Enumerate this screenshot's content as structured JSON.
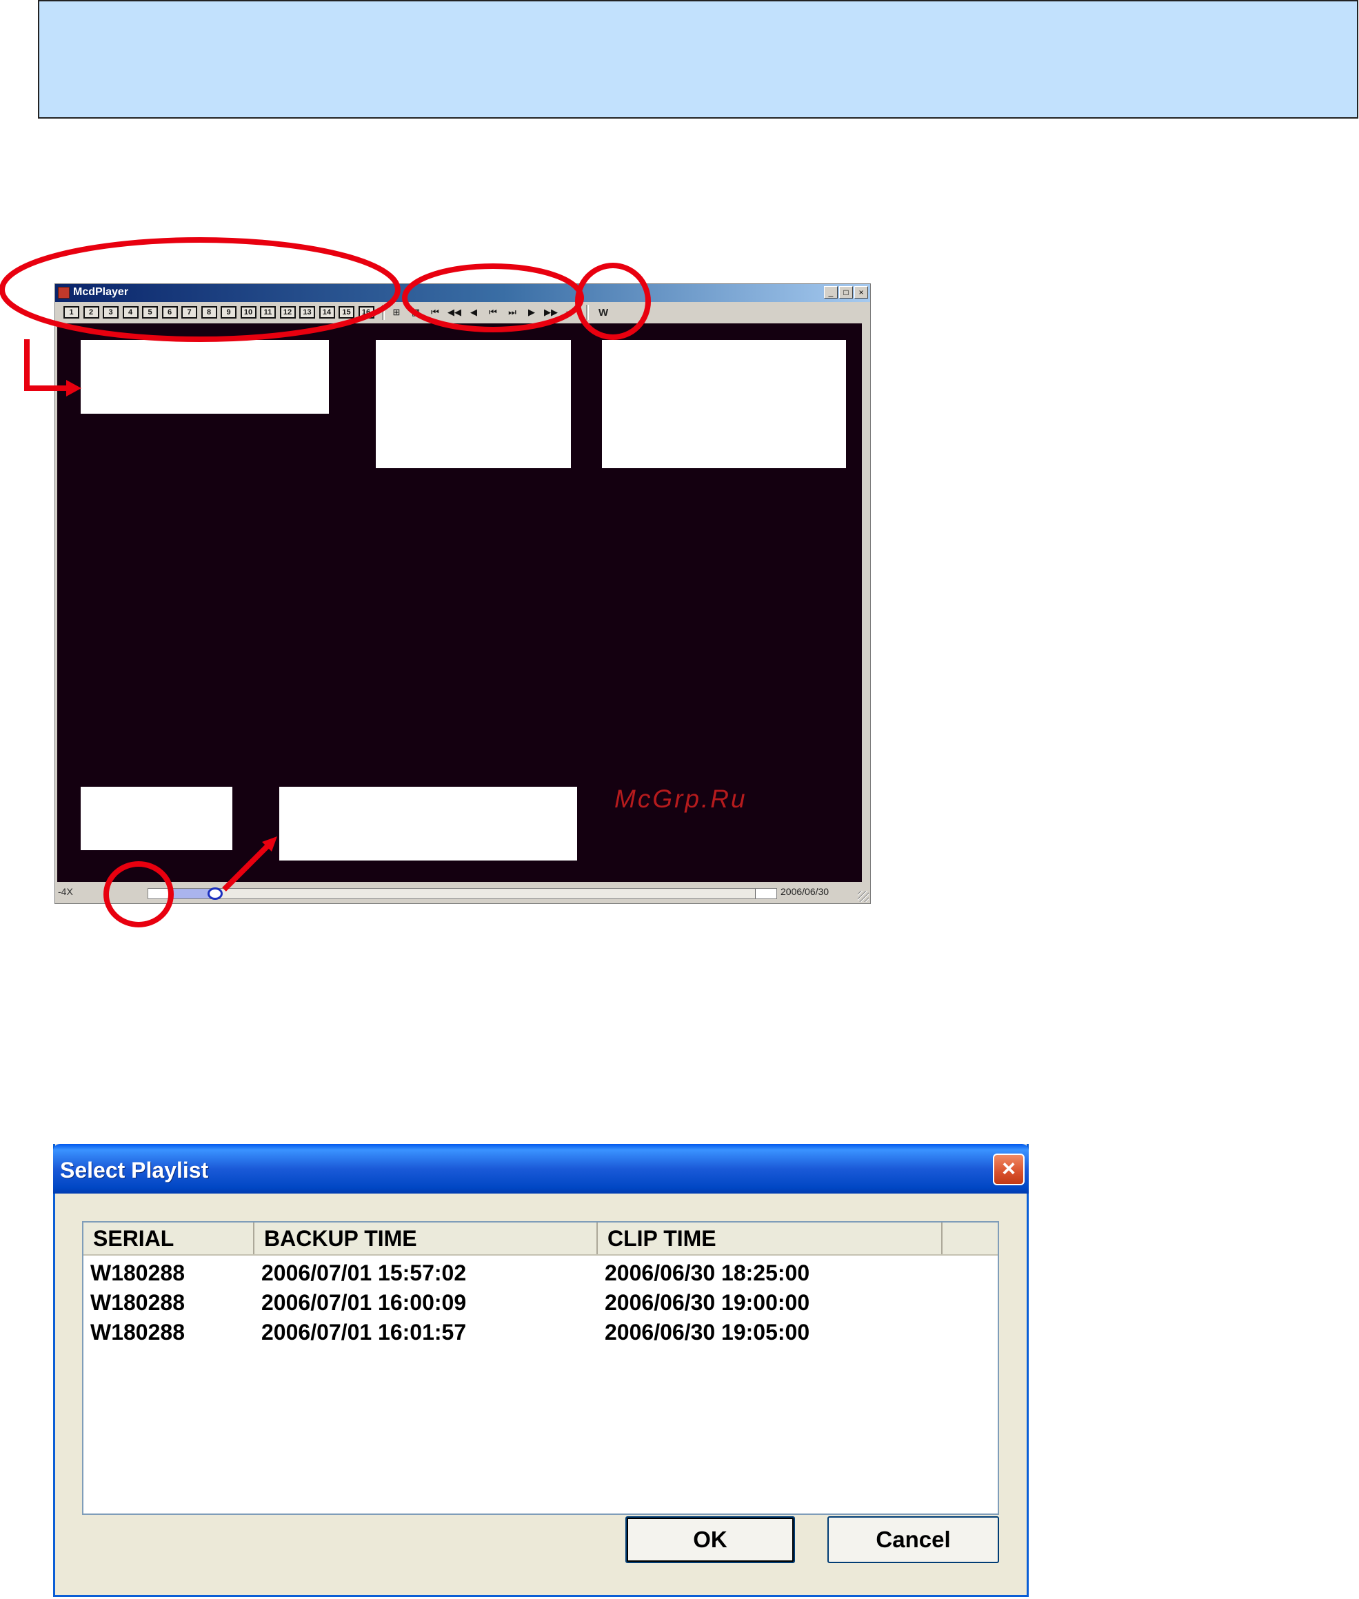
{
  "player": {
    "title": "McdPlayer",
    "window_buttons": [
      "_",
      "□",
      "×"
    ],
    "channel_buttons": [
      "1",
      "2",
      "3",
      "4",
      "5",
      "6",
      "7",
      "8",
      "9",
      "10",
      "11",
      "12",
      "13",
      "14",
      "15",
      "16"
    ],
    "transport_icons": [
      "quad-view-icon",
      "grid-view-icon",
      "fast-rewind-icon",
      "rewind-icon",
      "play-reverse-icon",
      "step-back-icon",
      "step-forward-icon",
      "play-icon",
      "fast-forward-icon",
      "skip-end-icon"
    ],
    "w_button": "W",
    "speed": "-4X",
    "date": "2006/06/30",
    "seek_position": 0.075
  },
  "watermark": "McGrp.Ru",
  "playlist_dialog": {
    "title": "Select Playlist",
    "close_glyph": "×",
    "columns": [
      "SERIAL",
      "BACKUP TIME",
      "CLIP TIME"
    ],
    "rows": [
      [
        "W180288",
        "2006/07/01 15:57:02",
        "2006/06/30 18:25:00"
      ],
      [
        "W180288",
        "2006/07/01 16:00:09",
        "2006/06/30 19:00:00"
      ],
      [
        "W180288",
        "2006/07/01 16:01:57",
        "2006/06/30 19:05:00"
      ]
    ],
    "ok_label": "OK",
    "cancel_label": "Cancel"
  },
  "colors": {
    "banner": "#c2e1fd",
    "annotation": "#e8000f",
    "screen": "#140010"
  }
}
